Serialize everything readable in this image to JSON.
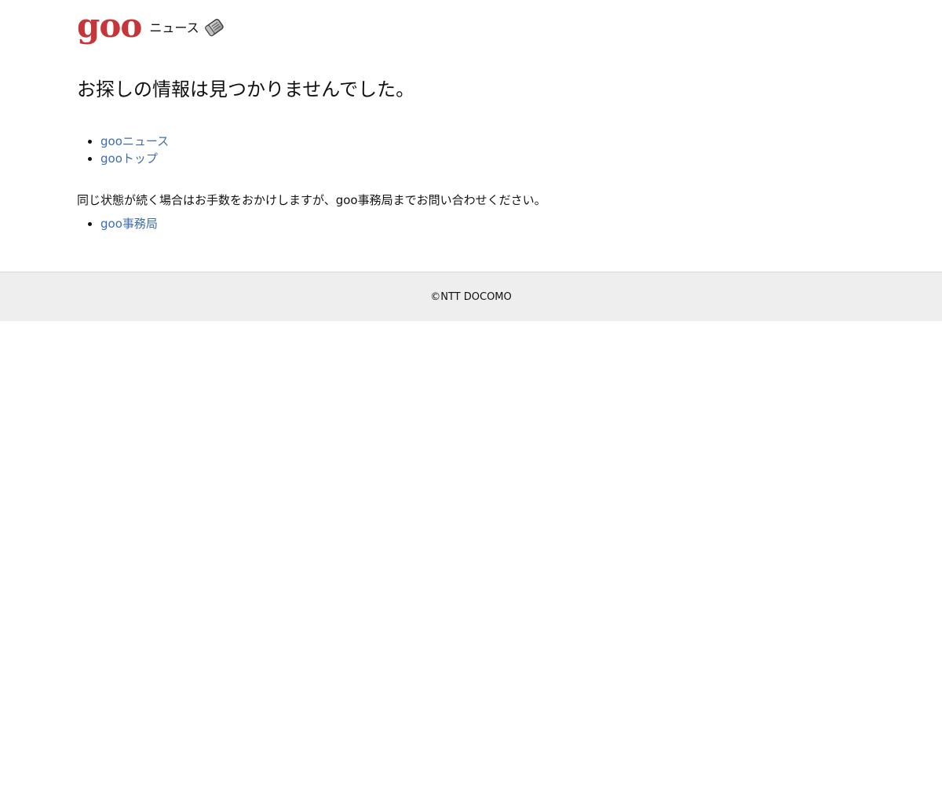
{
  "header": {
    "logo_text": "goo",
    "service_name": "ニュース",
    "icon": "newspaper-icon",
    "logo_color": "#c5363a"
  },
  "main": {
    "title": "お探しの情報は見つかりませんでした。",
    "links": [
      {
        "label": "gooニュース"
      },
      {
        "label": "gooトップ"
      }
    ],
    "notice": "同じ状態が続く場合はお手数をおかけしますが、goo事務局までお問い合わせください。",
    "office_link": {
      "label": "goo事務局"
    },
    "link_color": "#3b6dab"
  },
  "footer": {
    "copyright": "©NTT DOCOMO",
    "background": "#eeeeee"
  }
}
